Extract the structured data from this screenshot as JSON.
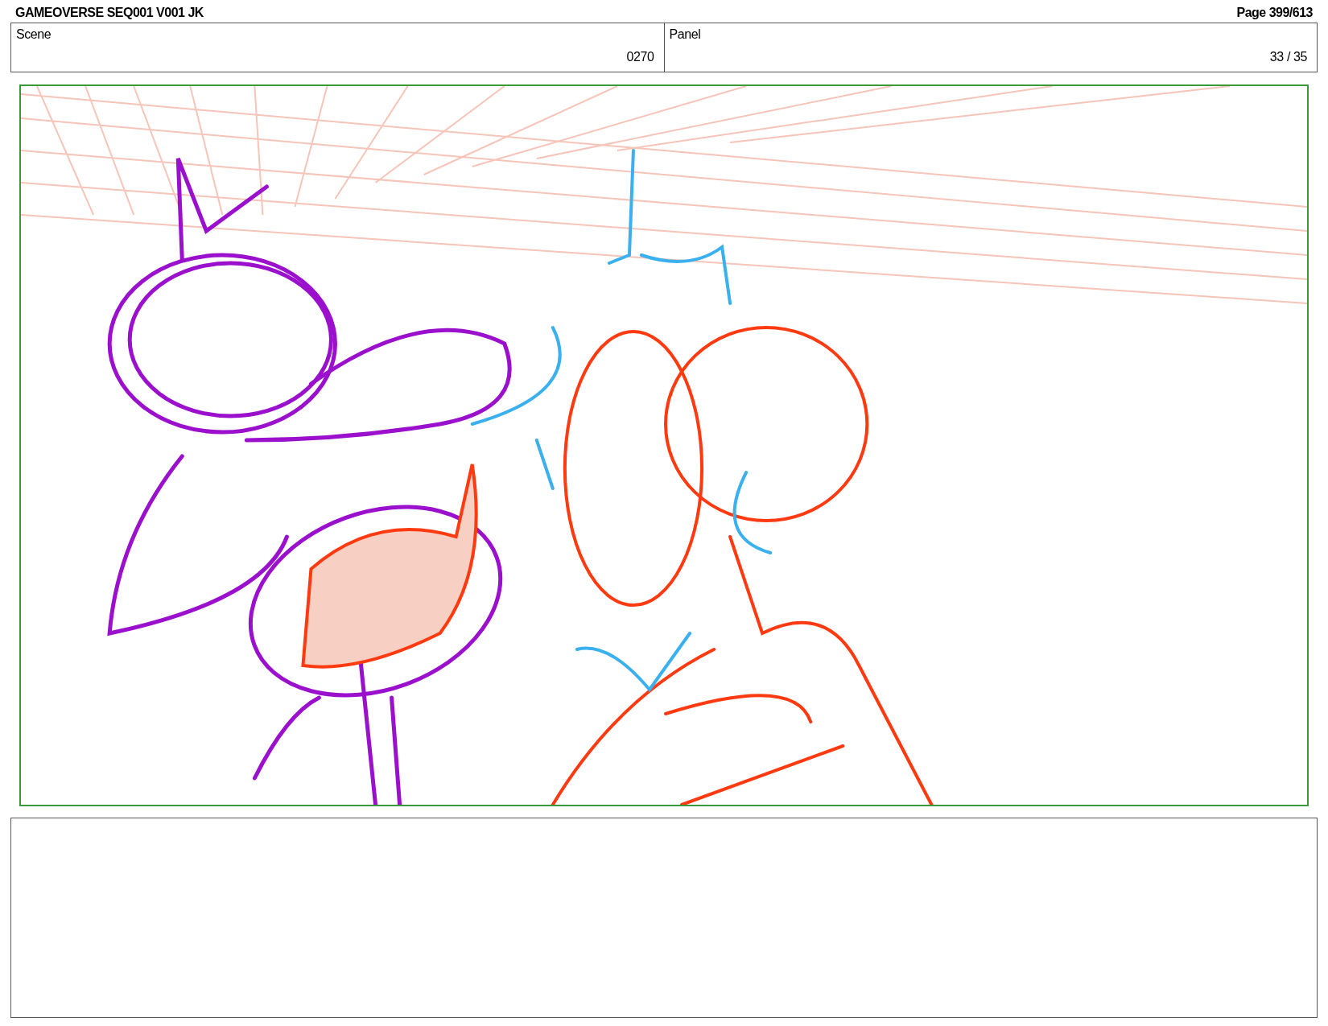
{
  "header": {
    "title": "GAMEOVERSE SEQ001 V001 JK",
    "page": "Page 399/613"
  },
  "info": [
    {
      "label": "Scene",
      "value": "0270"
    },
    {
      "label": "Panel",
      "value": "33 / 35"
    }
  ]
}
